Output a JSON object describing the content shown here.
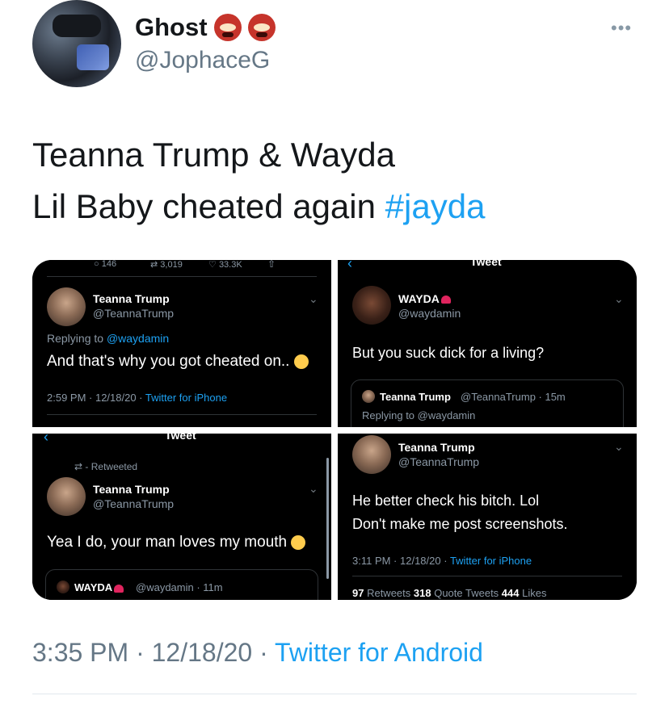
{
  "author": {
    "name": "Ghost",
    "name_emoji": [
      "ogre-icon",
      "ogre-icon"
    ],
    "handle": "@JophaceG"
  },
  "tweet": {
    "line1": "Teanna Trump & Wayda",
    "line2_text": "Lil Baby cheated again ",
    "hashtag": "#jayda"
  },
  "screenshots": {
    "s1": {
      "top_stats": [
        "146",
        "3,019",
        "33.3K"
      ],
      "name": "Teanna Trump",
      "handle": "@TeannaTrump",
      "replying_prefix": "Replying to ",
      "replying_handle": "@waydamin",
      "text": "And that's why you got cheated on..",
      "time": "2:59 PM · 12/18/20 · ",
      "source": "Twitter for iPhone"
    },
    "s2": {
      "header": "Tweet",
      "name": "WAYDA",
      "handle": "@waydamin",
      "text": "But you suck dick for a living?",
      "quote_name": "Teanna Trump",
      "quote_meta": "@TeannaTrump · 15m",
      "quote_replying": "Replying to @waydamin"
    },
    "s3": {
      "header": "Tweet",
      "retweeted": "Retweeted",
      "name": "Teanna Trump",
      "handle": "@TeannaTrump",
      "text": "Yea I do, your man loves my mouth",
      "quote_name": "WAYDA",
      "quote_meta": "@waydamin · 11m"
    },
    "s4": {
      "name": "Teanna Trump",
      "handle": "@TeannaTrump",
      "text_line1": "He better check his bitch. Lol",
      "text_line2": "Don't make me post screenshots.",
      "time": "3:11 PM · 12/18/20 · ",
      "source": "Twitter for iPhone",
      "retweets_count": "97",
      "retweets_label": " Retweets ",
      "quotes_count": "318",
      "quotes_label": " Quote Tweets ",
      "likes_count": "444",
      "likes_label": " Likes"
    }
  },
  "meta": {
    "time": "3:35 PM · 12/18/20 · ",
    "source": "Twitter for Android"
  },
  "colors": {
    "link": "#1da1f2",
    "secondary": "#657786",
    "dark_bg": "#000000"
  }
}
